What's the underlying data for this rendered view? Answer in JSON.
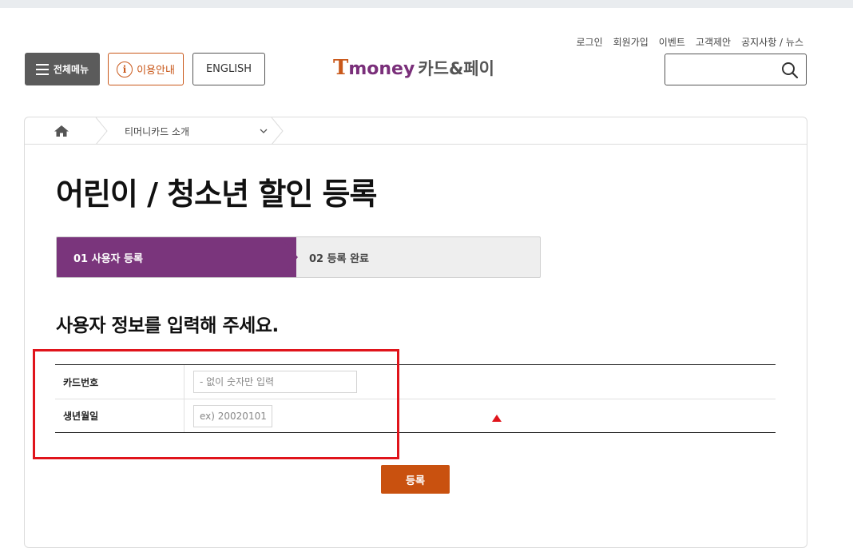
{
  "util_links": [
    "로그인",
    "회원가입",
    "이벤트",
    "고객제안",
    "공지사항 / 뉴스"
  ],
  "header": {
    "menu_label": "전체메뉴",
    "guide_label": "이용안내",
    "guide_icon_text": "i",
    "english_label": "ENGLISH",
    "logo_t": "T",
    "logo_money": "money",
    "logo_kr": "카드&페이",
    "search_placeholder": ""
  },
  "breadcrumb": {
    "current": "티머니카드 소개"
  },
  "page_title": "어린이 / 청소년 할인 등록",
  "steps": [
    {
      "label": "01 사용자 등록",
      "active": true
    },
    {
      "label": "02 등록 완료",
      "active": false
    }
  ],
  "section_title": "사용자 정보를 입력해 주세요.",
  "form": {
    "rows": [
      {
        "label": "카드번호",
        "placeholder": "- 없이 숫자만 입력",
        "value": ""
      },
      {
        "label": "생년월일",
        "placeholder": "ex) 20020101",
        "value": ""
      }
    ]
  },
  "submit_label": "등록",
  "colors": {
    "brand_purple": "#7a357c",
    "brand_orange": "#c9510f",
    "highlight_red": "#e0141b"
  }
}
